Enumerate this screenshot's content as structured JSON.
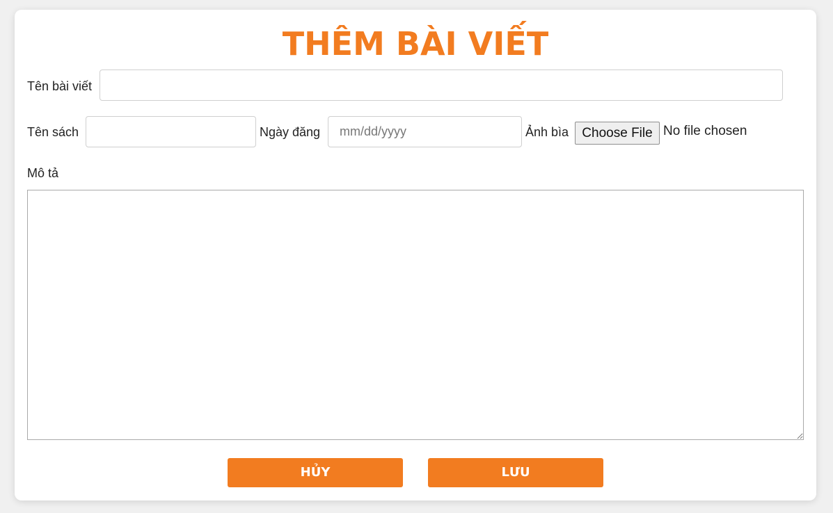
{
  "form": {
    "title": "THÊM BÀI VIẾT",
    "post_name_label": "Tên bài viết",
    "post_name_value": "",
    "book_name_label": "Tên sách",
    "book_name_value": "",
    "date_label": "Ngày đăng",
    "date_placeholder": "mm/dd/yyyy",
    "cover_label": "Ảnh bìa",
    "choose_file_label": "Choose File",
    "file_status": "No file chosen",
    "description_label": "Mô tả",
    "description_value": "",
    "cancel_label": "HỦY",
    "save_label": "LƯU"
  },
  "colors": {
    "accent": "#f27c20",
    "background": "#f0f0f0",
    "card": "#ffffff"
  }
}
